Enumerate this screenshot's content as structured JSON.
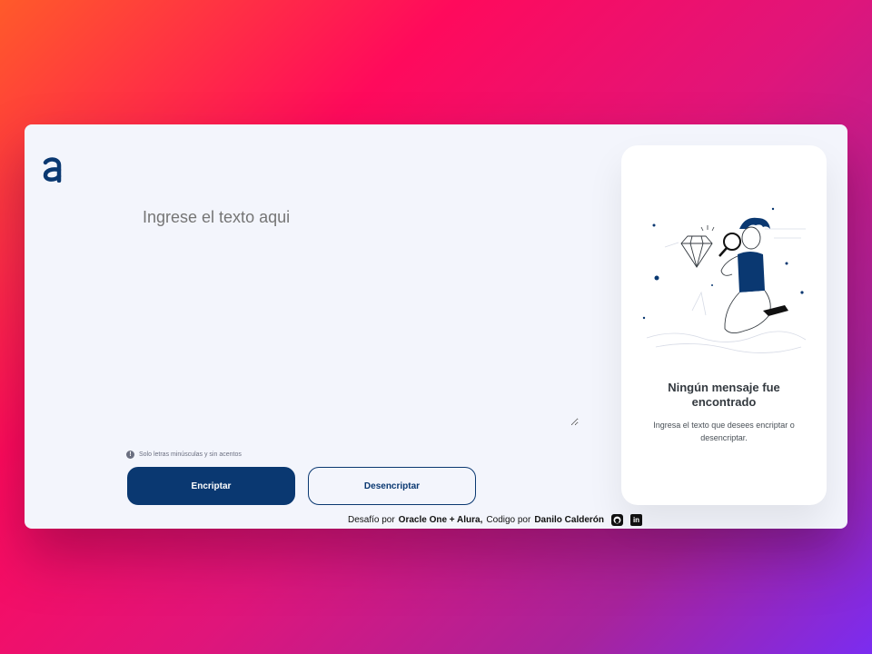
{
  "app": {
    "logo_icon": "alura-logo-icon",
    "brand_color": "#0a3871"
  },
  "main": {
    "input_placeholder": "Ingrese el texto aqui",
    "hint_text": "Solo letras minúsculas y sin acentos",
    "hint_icon": "info-icon",
    "encrypt_label": "Encriptar",
    "decrypt_label": "Desencriptar"
  },
  "panel": {
    "illustration": "person-with-magnifier-illustration",
    "title": "Ningún mensaje fue encontrado",
    "text": "Ingresa el texto que desees encriptar o desencriptar."
  },
  "footer": {
    "prefix": "Desafío por",
    "org": "Oracle One + Alura,",
    "middle": "Codigo por",
    "author": "Danilo Calderón",
    "github_icon": "github-icon",
    "linkedin_icon": "linkedin-icon",
    "linkedin_text": "in"
  }
}
